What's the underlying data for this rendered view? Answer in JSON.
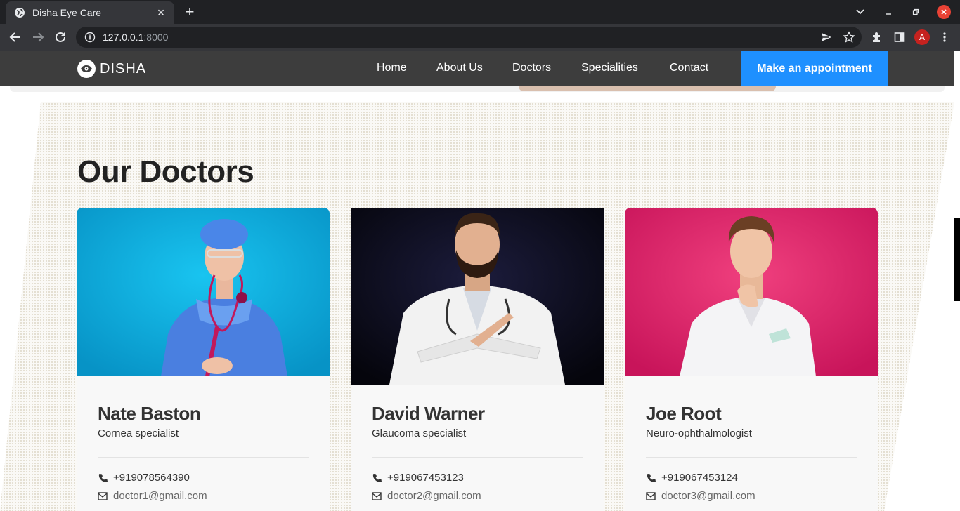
{
  "browser": {
    "tab_title": "Disha Eye Care",
    "url_host": "127.0.0.1",
    "url_port": ":8000",
    "profile_initial": "A"
  },
  "site": {
    "logo_text": "DISHA",
    "nav": [
      "Home",
      "About Us",
      "Doctors",
      "Specialities",
      "Contact"
    ],
    "cta_label": "Make an appointment"
  },
  "doctors_section": {
    "title": "Our Doctors",
    "doctors": [
      {
        "name": "Nate Baston",
        "speciality": "Cornea specialist",
        "phone": "+919078564390",
        "email": "doctor1@gmail.com"
      },
      {
        "name": "David Warner",
        "speciality": "Glaucoma specialist",
        "phone": "+919067453123",
        "email": "doctor2@gmail.com"
      },
      {
        "name": "Joe Root",
        "speciality": "Neuro-ophthalmologist",
        "phone": "+919067453124",
        "email": "doctor3@gmail.com"
      }
    ]
  },
  "colors": {
    "nav_bg": "#3d3d3d",
    "accent": "#1e90ff",
    "photo_bg_1": "#0aa3d8",
    "photo_bg_2": "#0b0b1e",
    "photo_bg_3": "#d81a62"
  },
  "icons": [
    "globe-icon",
    "back-icon",
    "forward-icon",
    "reload-icon",
    "info-icon",
    "share-icon",
    "star-icon",
    "extension-icon",
    "sidepanel-icon",
    "menu-icon",
    "eye-logo-icon",
    "phone-icon",
    "mail-icon"
  ]
}
